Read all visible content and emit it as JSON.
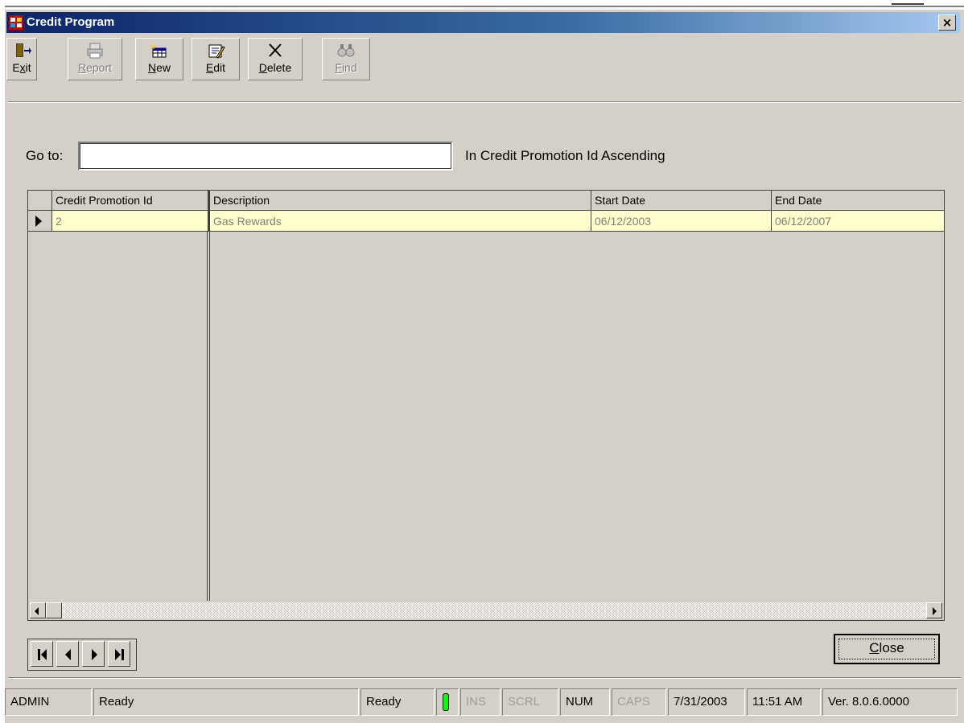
{
  "window": {
    "title": "Credit Program",
    "close_glyph": "×"
  },
  "toolbar": {
    "buttons": [
      {
        "label": "Exit",
        "mnemonic": "x",
        "icon": "exit-door-icon",
        "enabled": true
      },
      {
        "label": "Report",
        "mnemonic": "R",
        "icon": "printer-icon",
        "enabled": false
      },
      {
        "label": "New",
        "mnemonic": "N",
        "icon": "new-record-icon",
        "enabled": true
      },
      {
        "label": "Edit",
        "mnemonic": "E",
        "icon": "edit-icon",
        "enabled": true
      },
      {
        "label": "Delete",
        "mnemonic": "D",
        "icon": "delete-x-icon",
        "enabled": true
      },
      {
        "label": "Find",
        "mnemonic": "F",
        "icon": "binoculars-icon",
        "enabled": false
      }
    ]
  },
  "goto": {
    "label": "Go to:",
    "value": "",
    "order_text": "In Credit Promotion Id Ascending"
  },
  "grid": {
    "columns": [
      "Credit Promotion Id",
      "Description",
      "Start Date",
      "End Date"
    ],
    "rows": [
      [
        "2",
        "Gas Rewards",
        "06/12/2003",
        "06/12/2007"
      ]
    ],
    "selected_row_color": "#ffffcc"
  },
  "navigation": {
    "buttons": [
      "first-record",
      "previous-record",
      "next-record",
      "last-record"
    ]
  },
  "close_button": {
    "label": "Close",
    "mnemonic": "C"
  },
  "statusbar": {
    "user": "ADMIN",
    "status1": "Ready",
    "status2": "Ready",
    "ins": "INS",
    "scrl": "SCRL",
    "num": "NUM",
    "caps": "CAPS",
    "date": "7/31/2003",
    "time": "11:51 AM",
    "version": "Ver. 8.0.6.0000",
    "led_color": "#00ff00"
  }
}
